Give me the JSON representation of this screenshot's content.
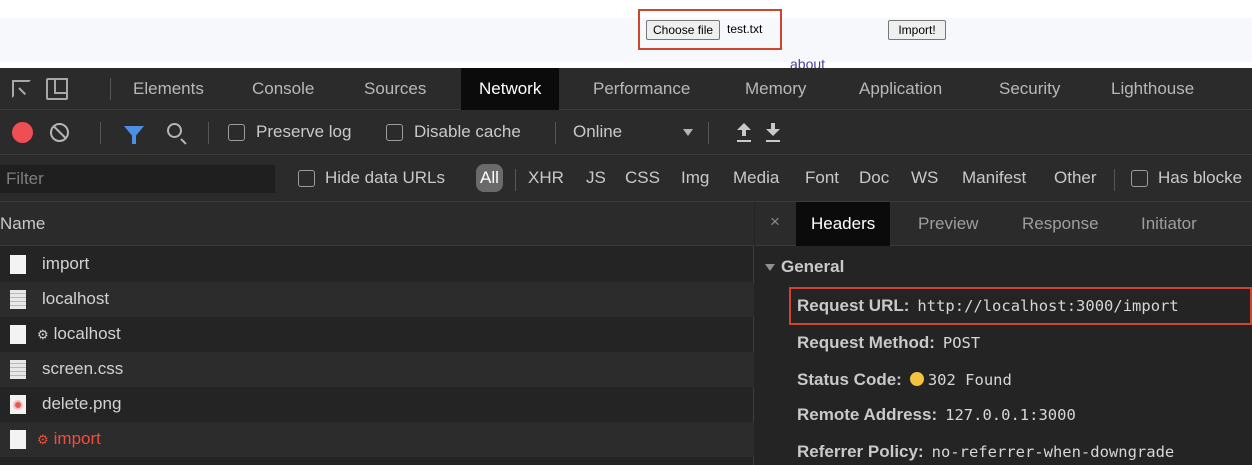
{
  "page": {
    "choose_file_label": "Choose file",
    "file_name": "test.txt",
    "import_button_label": "Import!",
    "about_link": "about"
  },
  "devtools": {
    "tabs": [
      "Elements",
      "Console",
      "Sources",
      "Network",
      "Performance",
      "Memory",
      "Application",
      "Security",
      "Lighthouse"
    ],
    "active_tab": "Network"
  },
  "toolbar": {
    "preserve_log": "Preserve log",
    "disable_cache": "Disable cache",
    "throttling": "Online"
  },
  "filter_bar": {
    "placeholder": "Filter",
    "hide_data_urls": "Hide data URLs",
    "types": [
      "All",
      "XHR",
      "JS",
      "CSS",
      "Img",
      "Media",
      "Font",
      "Doc",
      "WS",
      "Manifest",
      "Other"
    ],
    "has_blocked": "Has blocke"
  },
  "request_list": {
    "column_header": "Name",
    "rows": [
      {
        "name": "import",
        "gear": "",
        "error": false
      },
      {
        "name": "localhost",
        "gear": "",
        "error": false
      },
      {
        "name": "localhost",
        "gear": "⚙",
        "error": false
      },
      {
        "name": "screen.css",
        "gear": "",
        "error": false
      },
      {
        "name": "delete.png",
        "gear": "",
        "error": false
      },
      {
        "name": "import",
        "gear": "⚙",
        "error": true
      }
    ]
  },
  "details": {
    "close": "×",
    "tabs": [
      "Headers",
      "Preview",
      "Response",
      "Initiator"
    ],
    "active_tab": "Headers",
    "section_title": "General",
    "headers": [
      {
        "key": "Request URL:",
        "value": "http://localhost:3000/import"
      },
      {
        "key": "Request Method:",
        "value": "POST"
      },
      {
        "key": "Status Code:",
        "value": "302 Found"
      },
      {
        "key": "Remote Address:",
        "value": "127.0.0.1:3000"
      },
      {
        "key": "Referrer Policy:",
        "value": "no-referrer-when-downgrade"
      }
    ]
  },
  "colors": {
    "highlight": "#d0432f",
    "record": "#ee4e54",
    "filter_icon": "#4e8fe6",
    "error_text": "#ee4e40",
    "status_dot": "#f3c23e"
  }
}
